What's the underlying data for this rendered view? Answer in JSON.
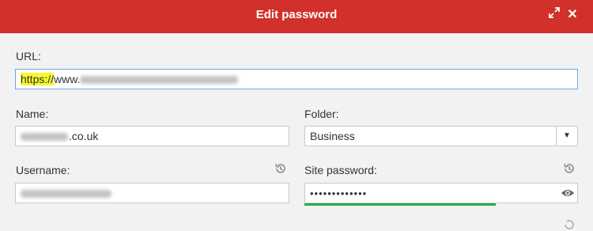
{
  "window": {
    "title": "Edit password",
    "expand_icon": "expand-icon",
    "close_icon": "close-icon"
  },
  "form": {
    "url": {
      "label": "URL:",
      "value_visible_prefix": "https://www.",
      "value_highlight": "https://",
      "value_after_highlight": "www."
    },
    "name": {
      "label": "Name:",
      "value_visible_suffix": ".co.uk"
    },
    "folder": {
      "label": "Folder:",
      "selected": "Business",
      "arrow_icon": "caret-down-icon"
    },
    "username": {
      "label": "Username:",
      "history_icon": "history-icon"
    },
    "site_password": {
      "label": "Site password:",
      "masked_value": "•••••••••••••",
      "history_icon": "history-icon",
      "reveal_icon": "eye-icon",
      "strength_fill": 0.66,
      "strength_color": "#2fa84f"
    }
  },
  "colors": {
    "titlebar": "#d2302a",
    "url_border": "#6ea8e0",
    "highlight": "#f7f72c"
  }
}
